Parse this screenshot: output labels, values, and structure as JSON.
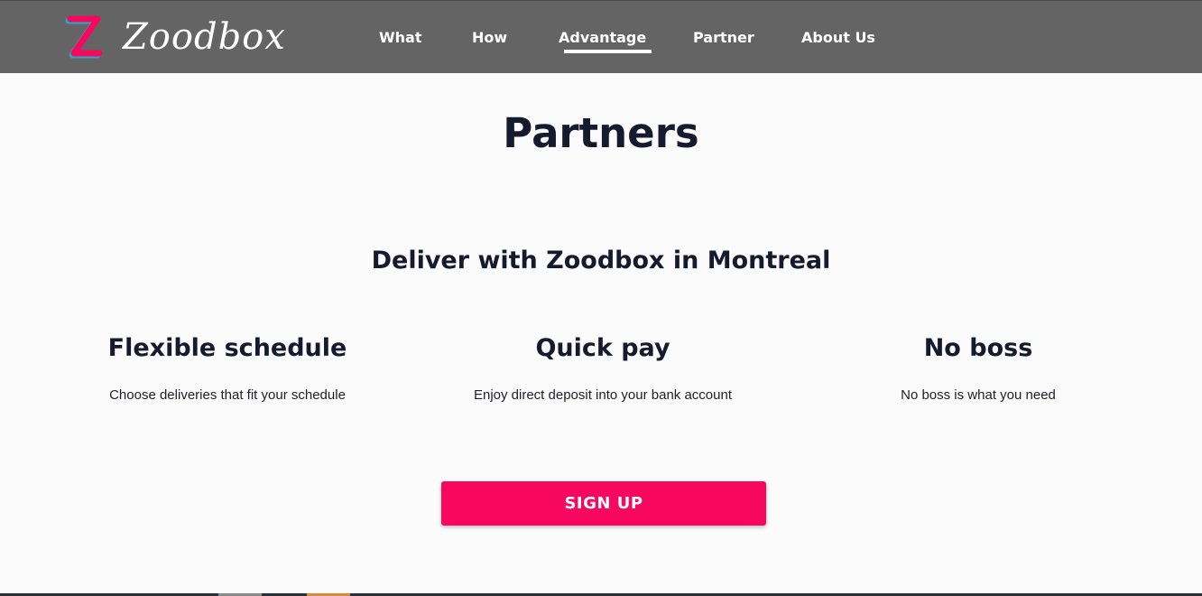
{
  "brand": {
    "name": "Zoodbox",
    "logo_letter": "Z",
    "accent_color": "#f8075f",
    "navbar_color": "#646464"
  },
  "nav": {
    "items": [
      {
        "label": "What"
      },
      {
        "label": "How"
      },
      {
        "label": "Advantage",
        "active": true
      },
      {
        "label": "Partner"
      },
      {
        "label": "About Us"
      }
    ]
  },
  "main": {
    "title": "Partners",
    "subtitle": "Deliver with Zoodbox in Montreal",
    "features": [
      {
        "title": "Flexible schedule",
        "description": "Choose deliveries that fit your schedule"
      },
      {
        "title": "Quick pay",
        "description": "Enjoy direct deposit into your bank account"
      },
      {
        "title": "No boss",
        "description": "No boss is what you need"
      }
    ],
    "signup_label": "SIGN UP"
  }
}
